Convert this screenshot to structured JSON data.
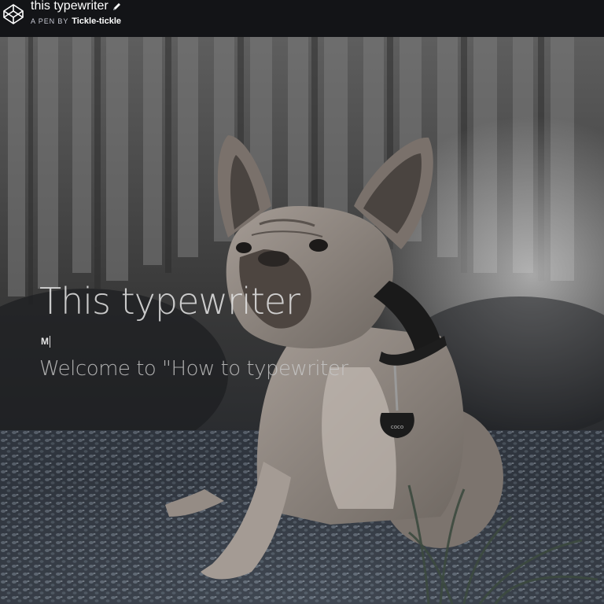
{
  "header": {
    "pen_title": "this typewriter",
    "byline_prefix": "A PEN BY",
    "author": "Tickle-tickle",
    "icons": {
      "logo": "codepen-logo-icon",
      "edit": "pencil-icon"
    }
  },
  "preview": {
    "image_description_icon": "french-bulldog-photo",
    "hero_title": "This typewriter",
    "typed_text": "M",
    "subtitle": "Welcome to \"How to typewriter"
  },
  "colors": {
    "header_bg": "#131417",
    "header_text": "#ffffff",
    "byline_text": "#c7c9d3"
  }
}
